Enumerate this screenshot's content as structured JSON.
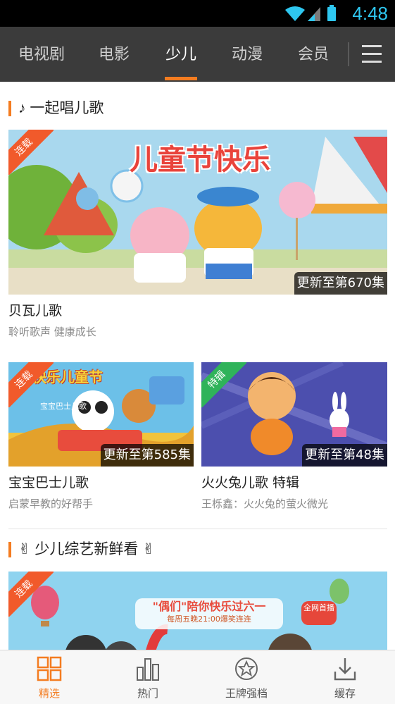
{
  "status_bar": {
    "time": "4:48"
  },
  "nav": {
    "tabs": [
      {
        "label": "电视剧",
        "active": false
      },
      {
        "label": "电影",
        "active": false
      },
      {
        "label": "少儿",
        "active": true
      },
      {
        "label": "动漫",
        "active": false
      },
      {
        "label": "会员",
        "active": false
      }
    ],
    "accent_color": "#f47c20"
  },
  "sections": [
    {
      "title": "♪ 一起唱儿歌",
      "featured": {
        "ribbon": "连载",
        "banner_text": "儿童节快乐",
        "episode_badge": "更新至第670集",
        "title": "贝瓦儿歌",
        "subtitle": "聆听歌声 健康成长"
      },
      "cards": [
        {
          "ribbon": "连载",
          "poster_text": "快乐儿童节",
          "poster_subtext": "宝宝巴士儿歌",
          "episode_badge": "更新至第585集",
          "title": "宝宝巴士儿歌",
          "subtitle": "启蒙早教的好帮手"
        },
        {
          "ribbon": "特辑",
          "episode_badge": "更新至第48集",
          "title": "火火兔儿歌 特辑",
          "subtitle": "王栎鑫：火火兔的萤火微光"
        }
      ]
    },
    {
      "title": "✌ 少儿综艺新鲜看 ✌",
      "featured": {
        "ribbon": "连载",
        "banner_text": "\"偶们\"陪你快乐过六一",
        "banner_subtext": "每周五晚21:00爆笑连连",
        "badge_text": "全网首播"
      }
    }
  ],
  "bottom_nav": [
    {
      "label": "精选",
      "icon": "grid-icon",
      "active": true
    },
    {
      "label": "热门",
      "icon": "bar-chart-icon",
      "active": false
    },
    {
      "label": "王牌强档",
      "icon": "star-badge-icon",
      "active": false
    },
    {
      "label": "缓存",
      "icon": "download-icon",
      "active": false
    }
  ]
}
